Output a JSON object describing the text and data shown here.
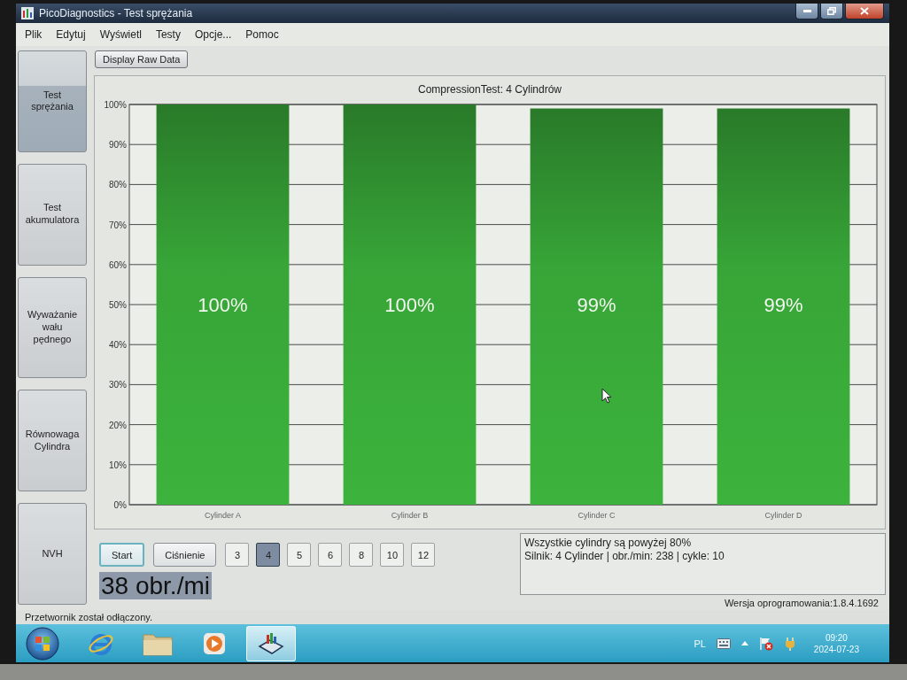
{
  "window": {
    "title": "PicoDiagnostics - Test sprężania"
  },
  "menu": [
    "Plik",
    "Edytuj",
    "Wyświetl",
    "Testy",
    "Opcje...",
    "Pomoc"
  ],
  "toolbar": {
    "raw_data_button": "Display Raw Data"
  },
  "sidebar": {
    "items": [
      {
        "label": "Test sprężania",
        "selected": true
      },
      {
        "label": "Test akumulatora",
        "selected": false
      },
      {
        "label": "Wyważanie wału pędnego",
        "selected": false
      },
      {
        "label": "Równowaga Cylindra",
        "selected": false
      },
      {
        "label": "NVH",
        "selected": false
      }
    ]
  },
  "chart": {
    "chart_data": {
      "type": "bar",
      "title": "CompressionTest: 4 Cylindrów",
      "categories": [
        "Cylinder A",
        "Cylinder B",
        "Cylinder C",
        "Cylinder D"
      ],
      "series": [
        {
          "color": "#3cb33c",
          "values": [
            100,
            100,
            99,
            99
          ]
        }
      ],
      "ylim": [
        0,
        100
      ],
      "yticks": [
        {
          "value": 0,
          "label": "0%"
        },
        {
          "value": 10,
          "label": "10%"
        },
        {
          "value": 20,
          "label": "20%"
        },
        {
          "value": 30,
          "label": "30%"
        },
        {
          "value": 40,
          "label": "40%"
        },
        {
          "value": 50,
          "label": "50%"
        },
        {
          "value": 60,
          "label": "60%"
        },
        {
          "value": 70,
          "label": "70%"
        },
        {
          "value": 80,
          "label": "80%"
        },
        {
          "value": 90,
          "label": "90%"
        },
        {
          "value": 100,
          "label": "100%"
        }
      ],
      "grid": true,
      "value_labels": [
        "100%",
        "100%",
        "99%",
        "99%"
      ]
    }
  },
  "controls": {
    "buttons": [
      {
        "label": "Start",
        "focused": true
      },
      {
        "label": "Ciśnienie",
        "focused": false
      }
    ],
    "cylinder_counts": [
      {
        "label": "3",
        "selected": false
      },
      {
        "label": "4",
        "selected": true
      },
      {
        "label": "5",
        "selected": false
      },
      {
        "label": "6",
        "selected": false
      },
      {
        "label": "8",
        "selected": false
      },
      {
        "label": "10",
        "selected": false
      },
      {
        "label": "12",
        "selected": false
      }
    ],
    "rpm_display": "38 obr./mi"
  },
  "info_box": {
    "lines": [
      "Wszystkie cylindry są powyżej 80%",
      "Silnik: 4 Cylinder | obr./min: 238 | cykle: 10"
    ]
  },
  "version": "Wersja oprogramowania:1.8.4.1692",
  "status_bar": "Przetwornik został odłączony.",
  "taskbar": {
    "apps": [
      {
        "kind": "browser",
        "selected": false
      },
      {
        "kind": "folder",
        "selected": false
      },
      {
        "kind": "media",
        "selected": false
      },
      {
        "kind": "chart",
        "selected": true
      }
    ],
    "tray": {
      "language": "PL",
      "time": "09:20",
      "date": "2024-07-23"
    }
  }
}
